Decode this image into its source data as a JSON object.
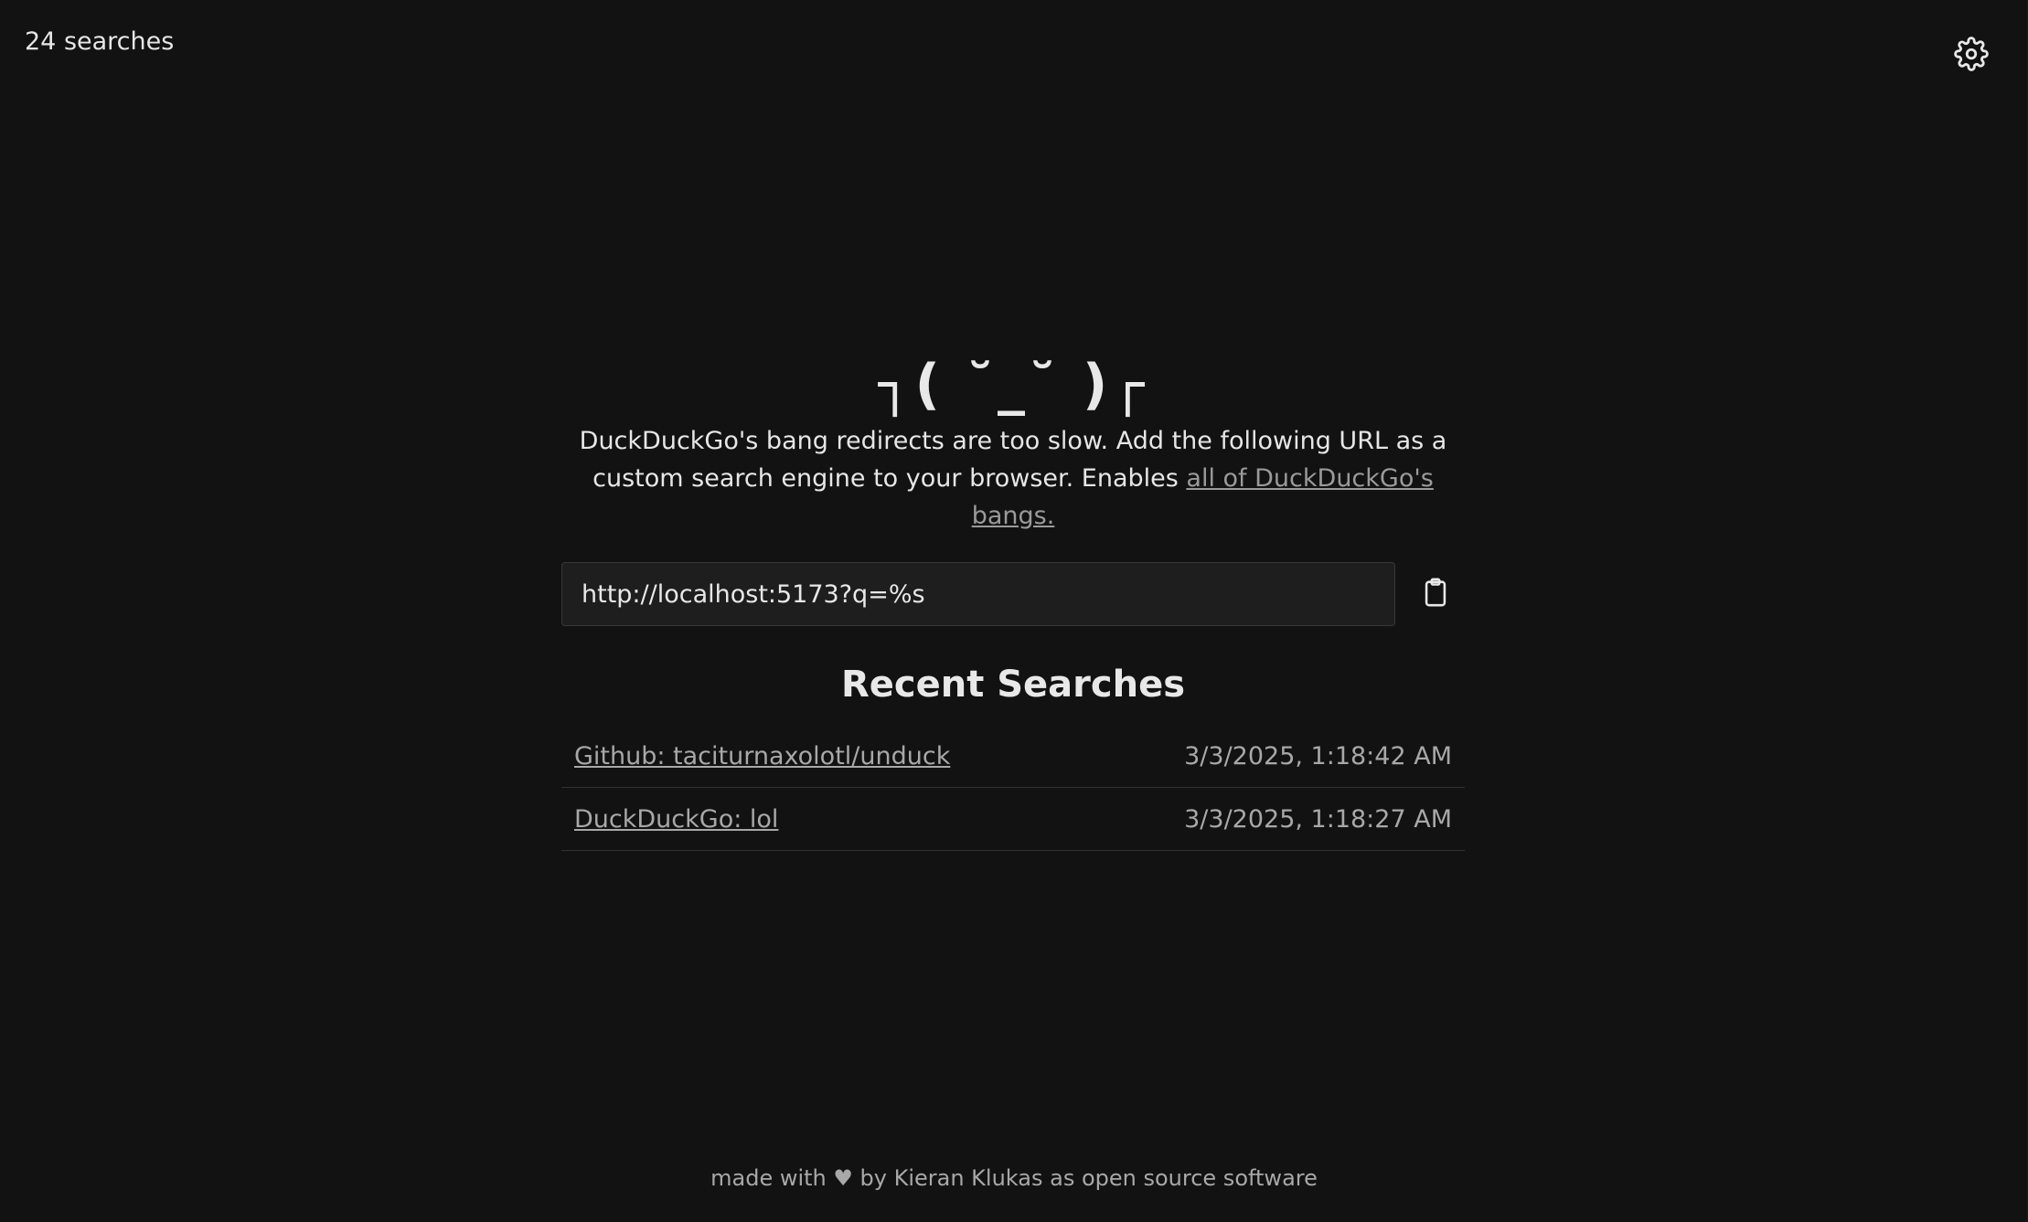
{
  "header": {
    "search_count": "24 searches",
    "settings_icon": "gear-icon"
  },
  "hero": {
    "kaomoji": "┐( ˘_˘ )┌",
    "description_text": "DuckDuckGo's bang redirects are too slow. Add the following URL as a custom search engine to your browser. Enables ",
    "description_link": "all of DuckDuckGo's bangs."
  },
  "url_field": {
    "value": "http://localhost:5173?q=%s",
    "copy_icon": "clipboard-icon"
  },
  "recent": {
    "title": "Recent Searches",
    "items": [
      {
        "label": "Github: taciturnaxolotl/unduck",
        "time": "3/3/2025, 1:18:42 AM"
      },
      {
        "label": "DuckDuckGo: lol",
        "time": "3/3/2025, 1:18:27 AM"
      }
    ]
  },
  "footer": {
    "text": "made with ♥ by Kieran Klukas as open source software"
  },
  "colors": {
    "background": "#121212",
    "text": "#e8e8e8",
    "muted": "#a8a8a8",
    "input_bg": "#1e1e1e"
  }
}
